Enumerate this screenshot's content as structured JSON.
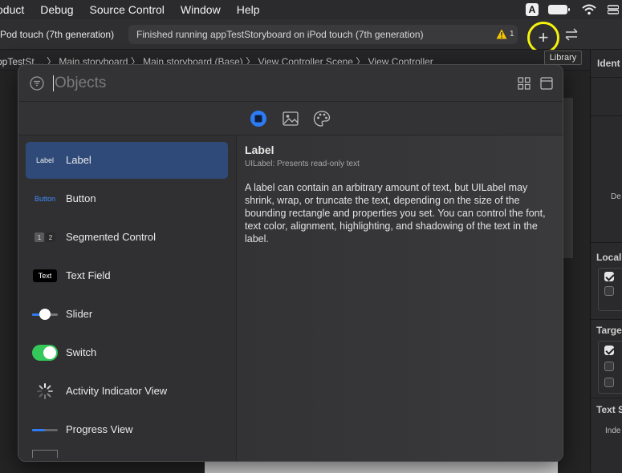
{
  "menubar": {
    "items": [
      "oduct",
      "Debug",
      "Source Control",
      "Window",
      "Help"
    ],
    "input_source": "A"
  },
  "toolbar": {
    "scheme": "Pod touch (7th generation)",
    "activity_text": "Finished running appTestStoryboard on iPod touch (7th generation)",
    "warning_count": "1",
    "add_label": "+",
    "tooltip": "Library"
  },
  "jumpbar": {
    "text": "ppTestSt… 〉 Main.storyboard 〉 Main.storyboard (Base) 〉 View Controller Scene 〉 View Controller"
  },
  "inspector": {
    "identity": "Ident",
    "de": "De",
    "localization": "Local",
    "target": "Targe",
    "text_settings": "Text S",
    "indent": "Inde"
  },
  "library": {
    "search_placeholder": "Objects",
    "items": [
      {
        "label": "Label",
        "thumb": "Label"
      },
      {
        "label": "Button",
        "thumb": "Button"
      },
      {
        "label": "Segmented Control",
        "thumb_a": "1",
        "thumb_b": "2"
      },
      {
        "label": "Text Field",
        "thumb": "Text"
      },
      {
        "label": "Slider"
      },
      {
        "label": "Switch"
      },
      {
        "label": "Activity Indicator View"
      },
      {
        "label": "Progress View"
      }
    ],
    "detail": {
      "title": "Label",
      "subtitle": "UILabel: Presents read-only text",
      "description": "A label can contain an arbitrary amount of text, but UILabel may shrink, wrap, or truncate the text, depending on the size of the bounding rectangle and properties you set. You can control the font, text color, alignment, highlighting, and shadowing of the text in the label."
    }
  },
  "colors": {
    "accent": "#2d7cf6",
    "selection": "#2f4a78",
    "highlight_circle": "#f5f30d",
    "switch_on": "#34c759",
    "warning": "#f5c400"
  }
}
